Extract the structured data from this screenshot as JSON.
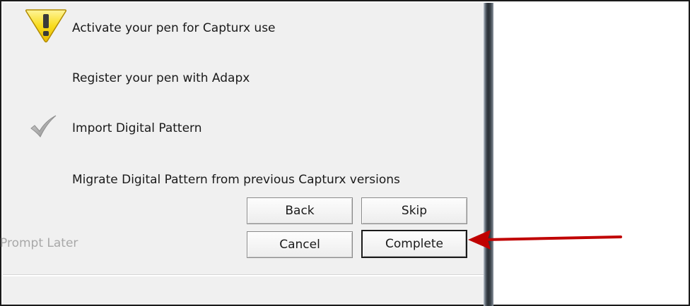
{
  "wizard": {
    "steps": [
      {
        "label": "Activate your pen for Capturx use",
        "state": "warning",
        "icon": "warning-icon"
      },
      {
        "label": "Register your pen with Adapx",
        "state": "none"
      },
      {
        "label": "Import Digital Pattern",
        "state": "done",
        "icon": "checkmark-icon"
      },
      {
        "label": "Migrate Digital Pattern from previous Capturx versions",
        "state": "none"
      }
    ],
    "buttons": {
      "back": "Back",
      "skip": "Skip",
      "cancel": "Cancel",
      "complete": "Complete"
    },
    "prompt_later": "Prompt Later"
  },
  "annotation": {
    "arrow_color": "#c00000",
    "target": "Complete"
  },
  "colors": {
    "panel_bg": "#f0f0f0",
    "warning_yellow": "#f5d515",
    "arrow_red": "#c00000"
  }
}
